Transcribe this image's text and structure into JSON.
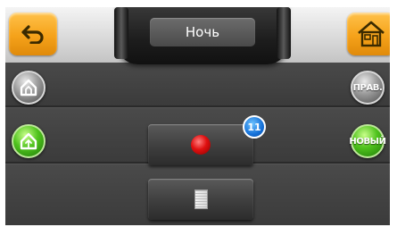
{
  "header": {
    "mode_title": "Ночь"
  },
  "icons": {
    "back": "back-arrow-icon",
    "home": "house-icon",
    "exit_scene": "house-exit-icon",
    "enter_scene": "house-enter-icon",
    "record": "record-dot-icon",
    "document": "document-icon"
  },
  "right_buttons": {
    "edit_label": "ПРАВ.",
    "new_label": "НОВЫЙ"
  },
  "notification": {
    "count": "11"
  },
  "colors": {
    "accent_orange": "#f5a21a",
    "active_green": "#4fc21d",
    "record_red": "#e01010",
    "badge_blue": "#1470d8"
  }
}
